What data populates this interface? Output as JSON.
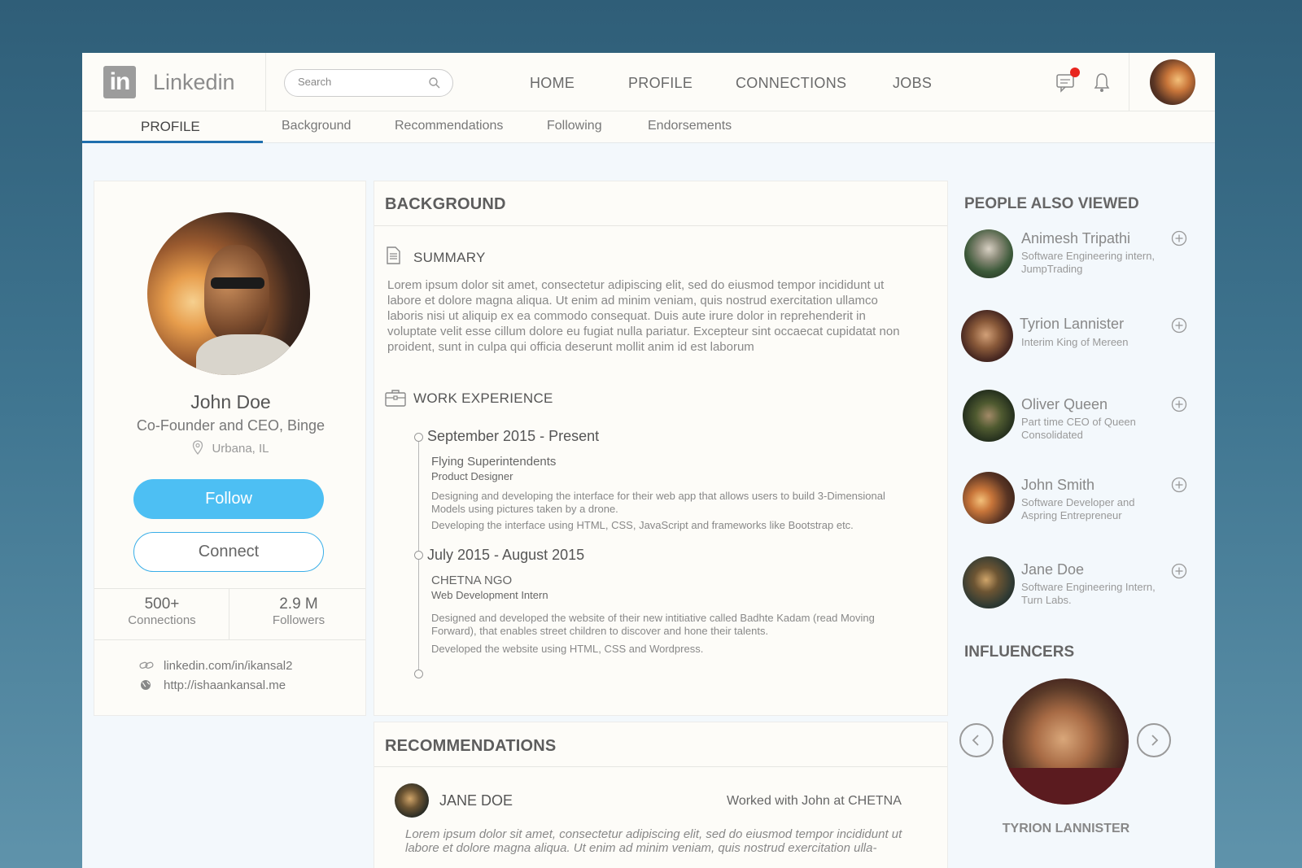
{
  "app": {
    "logo_text": "Linkedin",
    "logo_mark": "in"
  },
  "search": {
    "placeholder": "Search"
  },
  "nav": [
    {
      "label": "HOME"
    },
    {
      "label": "PROFILE"
    },
    {
      "label": "CONNECTIONS"
    },
    {
      "label": "JOBS"
    }
  ],
  "subnav": [
    {
      "label": "PROFILE"
    },
    {
      "label": "Background"
    },
    {
      "label": "Recommendations"
    },
    {
      "label": "Following"
    },
    {
      "label": "Endorsements"
    }
  ],
  "colors": {
    "accent": "#1f6fae",
    "follow_button": "#4dbff3",
    "notification_badge": "#e8261f"
  },
  "profile": {
    "name": "John Doe",
    "title": "Co-Founder and CEO, Binge",
    "location": "Urbana, IL",
    "follow_label": "Follow",
    "connect_label": "Connect",
    "connections_count": "500+",
    "connections_label": "Connections",
    "followers_count": "2.9 M",
    "followers_label": "Followers",
    "linkedin_url": "linkedin.com/in/ikansal2",
    "website": "http://ishaankansal.me"
  },
  "background": {
    "heading": "BACKGROUND",
    "summary_heading": "SUMMARY",
    "summary_text": "Lorem ipsum dolor sit amet, consectetur adipiscing elit, sed do eiusmod tempor incididunt ut labore et dolore magna aliqua. Ut enim ad minim veniam, quis nostrud exercitation ullamco laboris nisi ut aliquip ex ea commodo consequat. Duis aute irure dolor in reprehenderit in voluptate velit esse cillum dolore eu fugiat nulla pariatur. Excepteur sint occaecat cupidatat non proident, sunt in culpa qui officia deserunt mollit anim id est laborum",
    "work_heading": "WORK EXPERIENCE",
    "jobs": [
      {
        "date": "September 2015 - Present",
        "company": "Flying Superintendents",
        "role": "Product Designer",
        "desc1": "Designing and developing the interface for their web app that allows users to build 3-Dimensional Models using pictures taken by a drone.",
        "desc2": "Developing the interface using HTML, CSS, JavaScript and frameworks like Bootstrap etc."
      },
      {
        "date": "July 2015 - August 2015",
        "company": "CHETNA NGO",
        "role": "Web Development Intern",
        "desc1": "Designed and developed the website of their new intitiative called Badhte Kadam (read Moving Forward), that enables street children to discover and hone their talents.",
        "desc2": "Developed the website using HTML, CSS and Wordpress."
      }
    ]
  },
  "recommendations": {
    "heading": "RECOMMENDATIONS",
    "items": [
      {
        "name": "JANE DOE",
        "relation": "Worked with John at CHETNA",
        "text": "Lorem ipsum dolor sit amet, consectetur adipiscing elit, sed do eiusmod tempor incididunt ut labore et dolore magna aliqua. Ut enim ad minim veniam, quis nostrud exercitation ulla-"
      }
    ]
  },
  "people_also_viewed": {
    "heading": "PEOPLE ALSO VIEWED",
    "items": [
      {
        "name": "Animesh Tripathi",
        "subtitle": "Software Engineering intern, JumpTrading"
      },
      {
        "name": "Tyrion Lannister",
        "subtitle": "Interim King of Mereen"
      },
      {
        "name": "Oliver Queen",
        "subtitle": "Part time CEO of Queen Consolidated"
      },
      {
        "name": "John Smith",
        "subtitle": "Software Developer and Aspring Entrepreneur"
      },
      {
        "name": "Jane Doe",
        "subtitle": "Software Engineering Intern, Turn Labs."
      }
    ]
  },
  "influencers": {
    "heading": "INFLUENCERS",
    "current_name": "TYRION LANNISTER"
  }
}
